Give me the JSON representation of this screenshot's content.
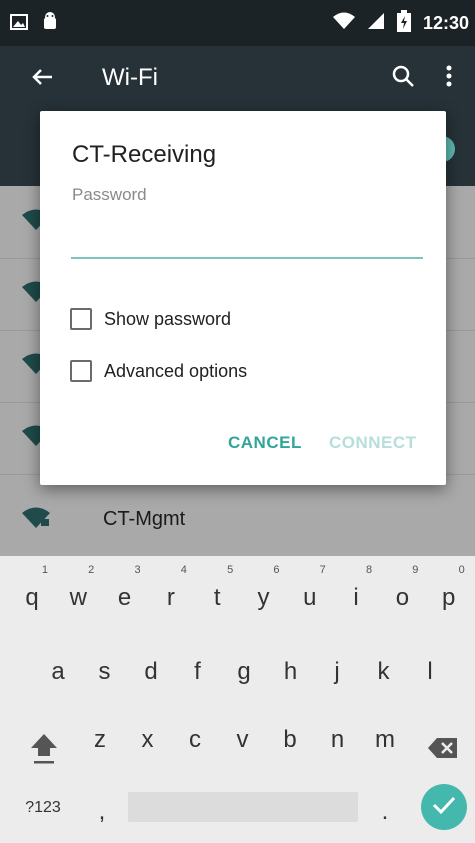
{
  "status_bar": {
    "time": "12:30"
  },
  "app_bar": {
    "title": "Wi-Fi"
  },
  "wifi_list": {
    "visible_network": "CT-Mgmt"
  },
  "dialog": {
    "network_name": "CT-Receiving",
    "password_label": "Password",
    "password_value": "",
    "show_password_label": "Show password",
    "show_password_checked": false,
    "advanced_options_label": "Advanced options",
    "advanced_options_checked": false,
    "cancel_label": "CANCEL",
    "connect_label": "CONNECT"
  },
  "keyboard": {
    "row1": [
      {
        "k": "q",
        "hint": "1"
      },
      {
        "k": "w",
        "hint": "2"
      },
      {
        "k": "e",
        "hint": "3"
      },
      {
        "k": "r",
        "hint": "4"
      },
      {
        "k": "t",
        "hint": "5"
      },
      {
        "k": "y",
        "hint": "6"
      },
      {
        "k": "u",
        "hint": "7"
      },
      {
        "k": "i",
        "hint": "8"
      },
      {
        "k": "o",
        "hint": "9"
      },
      {
        "k": "p",
        "hint": "0"
      }
    ],
    "row2": [
      "a",
      "s",
      "d",
      "f",
      "g",
      "h",
      "j",
      "k",
      "l"
    ],
    "row3": [
      "z",
      "x",
      "c",
      "v",
      "b",
      "n",
      "m"
    ],
    "symbols_label": "?123",
    "comma": ",",
    "period": "."
  },
  "colors": {
    "accent": "#31a59c",
    "accent_disabled": "#b6dfdb",
    "app_bar": "#263238",
    "status_bar": "#1c2326",
    "enter_key": "#45b8ad"
  },
  "icons": [
    "image-icon",
    "android-icon",
    "wifi-icon",
    "signal-icon",
    "battery-icon",
    "back-arrow-icon",
    "search-icon",
    "more-vert-icon",
    "wifi-lock-icon",
    "shift-icon",
    "backspace-icon",
    "check-icon"
  ]
}
